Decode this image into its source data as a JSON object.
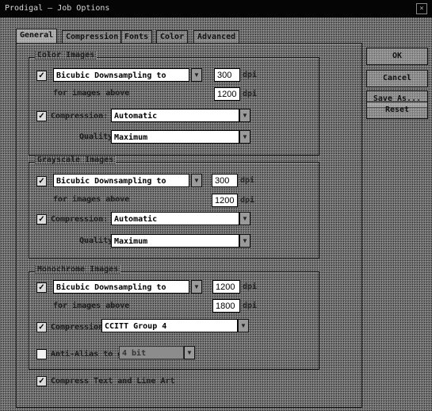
{
  "window": {
    "title": "Prodigal — Job Options",
    "close_glyph": "×"
  },
  "tabs": [
    {
      "label": "General"
    },
    {
      "label": "Compression"
    },
    {
      "label": "Fonts"
    },
    {
      "label": "Color"
    },
    {
      "label": "Advanced"
    }
  ],
  "side_buttons": [
    {
      "label": "OK"
    },
    {
      "label": "Cancel"
    },
    {
      "label": "Save As..."
    },
    {
      "label": "Reset"
    }
  ],
  "color_images": {
    "group_label": "Color Images",
    "downsample": {
      "checked": true,
      "method": "Bicubic Downsampling to",
      "value": "300",
      "unit": "dpi"
    },
    "above": {
      "label": "for images above",
      "value": "1200",
      "unit": "dpi"
    },
    "compression": {
      "checked": true,
      "label": "Compression:",
      "value": "Automatic"
    },
    "quality": {
      "label": "Quality:",
      "value": "Maximum"
    }
  },
  "grayscale_images": {
    "group_label": "Grayscale Images",
    "downsample": {
      "checked": true,
      "method": "Bicubic Downsampling to",
      "value": "300",
      "unit": "dpi"
    },
    "above": {
      "label": "for images above",
      "value": "1200",
      "unit": "dpi"
    },
    "compression": {
      "checked": true,
      "label": "Compression:",
      "value": "Automatic"
    },
    "quality": {
      "label": "Quality:",
      "value": "Maximum"
    }
  },
  "monochrome_images": {
    "group_label": "Monochrome Images",
    "downsample": {
      "checked": true,
      "method": "Bicubic Downsampling to",
      "value": "1200",
      "unit": "dpi"
    },
    "above": {
      "label": "for images above",
      "value": "1800",
      "unit": "dpi"
    },
    "compression": {
      "checked": true,
      "label": "Compression:",
      "value": "CCITT Group 4"
    },
    "antialias": {
      "checked": false,
      "label": "Anti-Alias to gray:",
      "value": "4 bit"
    }
  },
  "compress_text": {
    "checked": true,
    "label": "Compress Text and Line Art"
  }
}
